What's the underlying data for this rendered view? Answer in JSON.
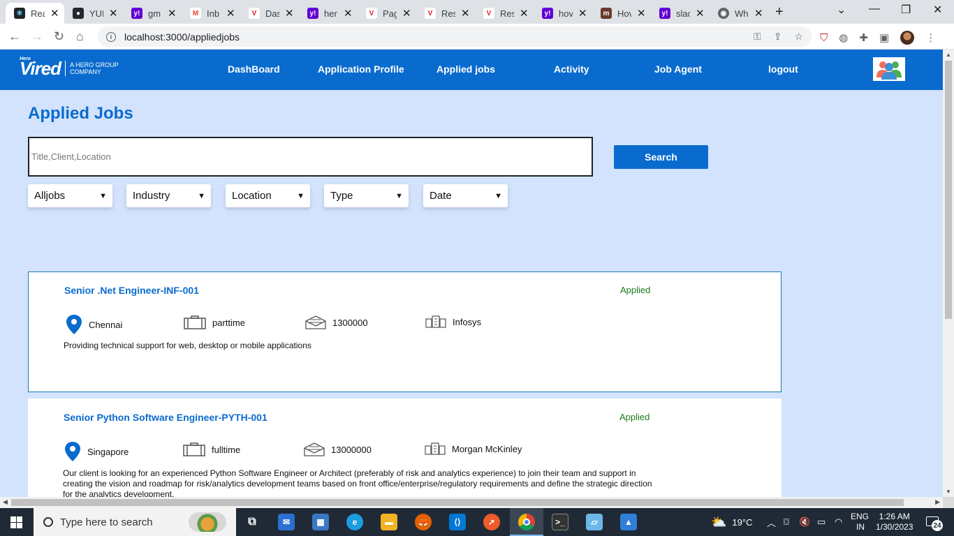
{
  "browser": {
    "tabs": [
      {
        "title": "React App",
        "color": "#20232a",
        "glyph": "⚛"
      },
      {
        "title": "YUE",
        "color": "#24292f",
        "glyph": "●"
      },
      {
        "title": "gmail",
        "color": "#6001d2",
        "glyph": "y!"
      },
      {
        "title": "Inbox",
        "color": "#ea4335",
        "glyph": "M"
      },
      {
        "title": "Dashboard",
        "color": "#e41e26",
        "glyph": "V"
      },
      {
        "title": "hero",
        "color": "#6001d2",
        "glyph": "y!"
      },
      {
        "title": "Page",
        "color": "#e41e26",
        "glyph": "V"
      },
      {
        "title": "Results",
        "color": "#e41e26",
        "glyph": "V"
      },
      {
        "title": "Results",
        "color": "#e41e26",
        "glyph": "V"
      },
      {
        "title": "how",
        "color": "#6001d2",
        "glyph": "y!"
      },
      {
        "title": "How",
        "color": "#2d2d2d",
        "glyph": "m"
      },
      {
        "title": "slack",
        "color": "#6001d2",
        "glyph": "y!"
      },
      {
        "title": "What",
        "color": "#5f6368",
        "glyph": "◉"
      }
    ],
    "tab_titles_short": [
      "Rea",
      "YUE",
      "gm",
      "Inb",
      "Das",
      "her",
      "Pag",
      "Res",
      "Res",
      "hov",
      "Hov",
      "slac",
      "Wh"
    ],
    "url": "localhost:3000/appliedjobs"
  },
  "nav": {
    "logo_top": "Hero",
    "logo_main": "Vired",
    "logo_sub1": "A HERO GROUP",
    "logo_sub2": "COMPANY",
    "links": [
      "DashBoard",
      "Application Profile",
      "Applied jobs",
      "Activity",
      "Job Agent",
      "logout"
    ]
  },
  "page": {
    "title": "Applied Jobs",
    "search_placeholder": "Title,Client,Location",
    "search_button": "Search",
    "filters": [
      "Alljobs",
      "Industry",
      "Location",
      "Type",
      "Date"
    ]
  },
  "jobs": [
    {
      "title": "Senior .Net Engineer-INF-001",
      "status": "Applied",
      "location": "Chennai",
      "type": "parttime",
      "salary": "1300000",
      "company": "Infosys",
      "description": "Providing technical support for web, desktop or mobile applications"
    },
    {
      "title": "Senior Python Software Engineer-PYTH-001",
      "status": "Applied",
      "location": "Singapore",
      "type": "fulltime",
      "salary": "13000000",
      "company": "Morgan McKinley",
      "description": "Our client is looking for an experienced Python Software Engineer or Architect (preferably of risk and analytics experience) to join their team and support in creating the vision and roadmap for risk/analytics development teams based on front office/enterprise/regulatory requirements and define the strategic direction for the analytics development."
    }
  ],
  "taskbar": {
    "search_placeholder": "Type here to search",
    "weather": "19°C",
    "lang1": "ENG",
    "lang2": "IN",
    "time": "1:26 AM",
    "date": "1/30/2023",
    "notifications": "24"
  },
  "colors": {
    "brand": "#0a6bce",
    "page_bg": "#d3e3fd",
    "applied": "#1b7a1b"
  }
}
